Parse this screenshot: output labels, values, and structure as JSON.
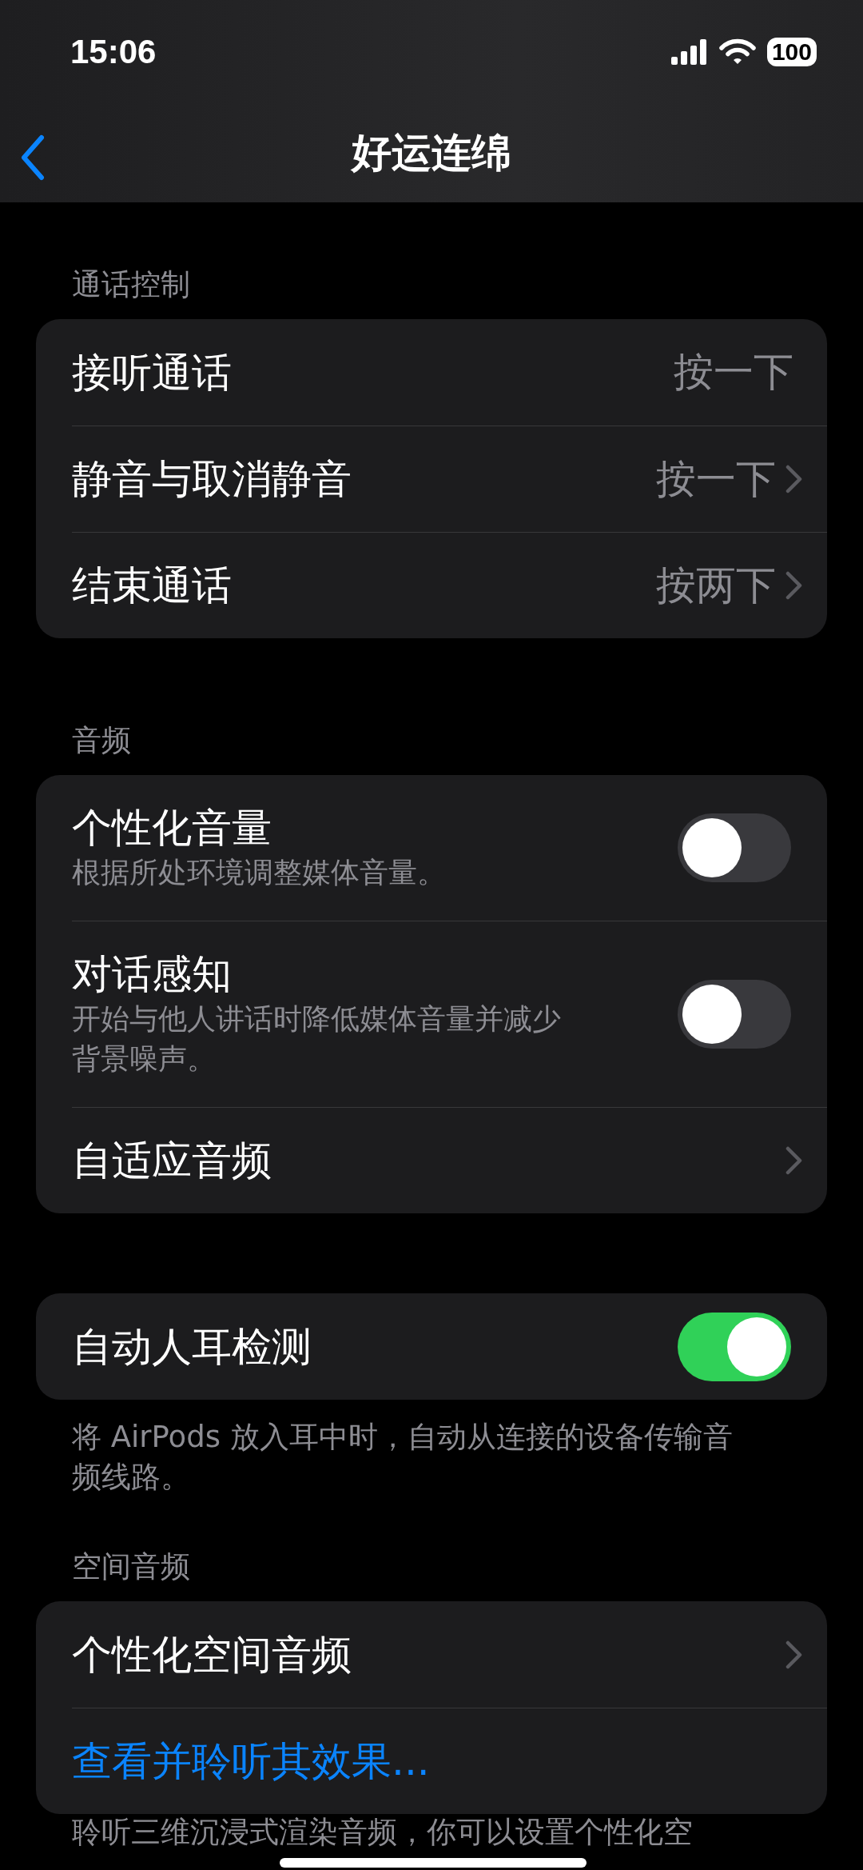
{
  "status_bar": {
    "time": "15:06",
    "battery": "100"
  },
  "nav": {
    "title": "好运连绵"
  },
  "sections": [
    {
      "header": "通话控制",
      "rows": [
        {
          "kind": "value",
          "title": "接听通话",
          "value": "按一下",
          "chevron": false
        },
        {
          "kind": "value",
          "title": "静音与取消静音",
          "value": "按一下",
          "chevron": true
        },
        {
          "kind": "value",
          "title": "结束通话",
          "value": "按两下",
          "chevron": true
        }
      ]
    },
    {
      "header": "音频",
      "rows": [
        {
          "kind": "toggle",
          "title": "个性化音量",
          "subtitle": "根据所处环境调整媒体音量。",
          "on": false
        },
        {
          "kind": "toggle",
          "title": "对话感知",
          "subtitle": "开始与他人讲话时降低媒体音量并减少背景噪声。",
          "on": false
        },
        {
          "kind": "link",
          "title": "自适应音频"
        }
      ]
    },
    {
      "rows": [
        {
          "kind": "toggle",
          "title": "自动人耳检测",
          "on": true
        }
      ],
      "footer": "将 AirPods 放入耳中时，自动从连接的设备传输音频线路。"
    },
    {
      "header": "空间音频",
      "rows": [
        {
          "kind": "link",
          "title": "个性化空间音频"
        },
        {
          "kind": "action",
          "title": "查看并聆听其效果..."
        }
      ],
      "footer": "聆听三维沉浸式渲染音频，你可以设置个性化空"
    }
  ]
}
